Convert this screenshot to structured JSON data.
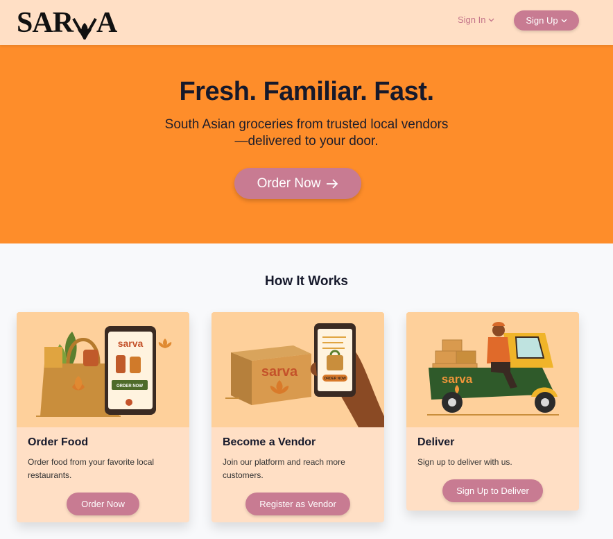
{
  "header": {
    "logo_left": "SAR",
    "logo_right": "A",
    "signin_label": "Sign In",
    "signup_label": "Sign Up"
  },
  "hero": {
    "title": "Fresh. Familiar. Fast.",
    "subtitle": "South Asian groceries from trusted local vendors—delivered to your door.",
    "cta_label": "Order Now"
  },
  "how": {
    "title": "How It Works",
    "cards": [
      {
        "title": "Order Food",
        "desc": "Order food from your favorite local restaurants.",
        "button": "Order Now",
        "art_brand": "sarva",
        "art_button": "ORDER NOW"
      },
      {
        "title": "Become a Vendor",
        "desc": "Join our platform and reach more customers.",
        "button": "Register as Vendor",
        "art_brand": "sarva",
        "art_button": "ORDER NOW"
      },
      {
        "title": "Deliver",
        "desc": "Sign up to deliver with us.",
        "button": "Sign Up to Deliver",
        "art_brand": "sarva"
      }
    ]
  },
  "colors": {
    "header_bg": "#ffdfc5",
    "hero_bg": "#fe8d2a",
    "accent": "#c87b92",
    "card_bg": "#ffdfc5",
    "illustration_bg": "#fed09b"
  }
}
